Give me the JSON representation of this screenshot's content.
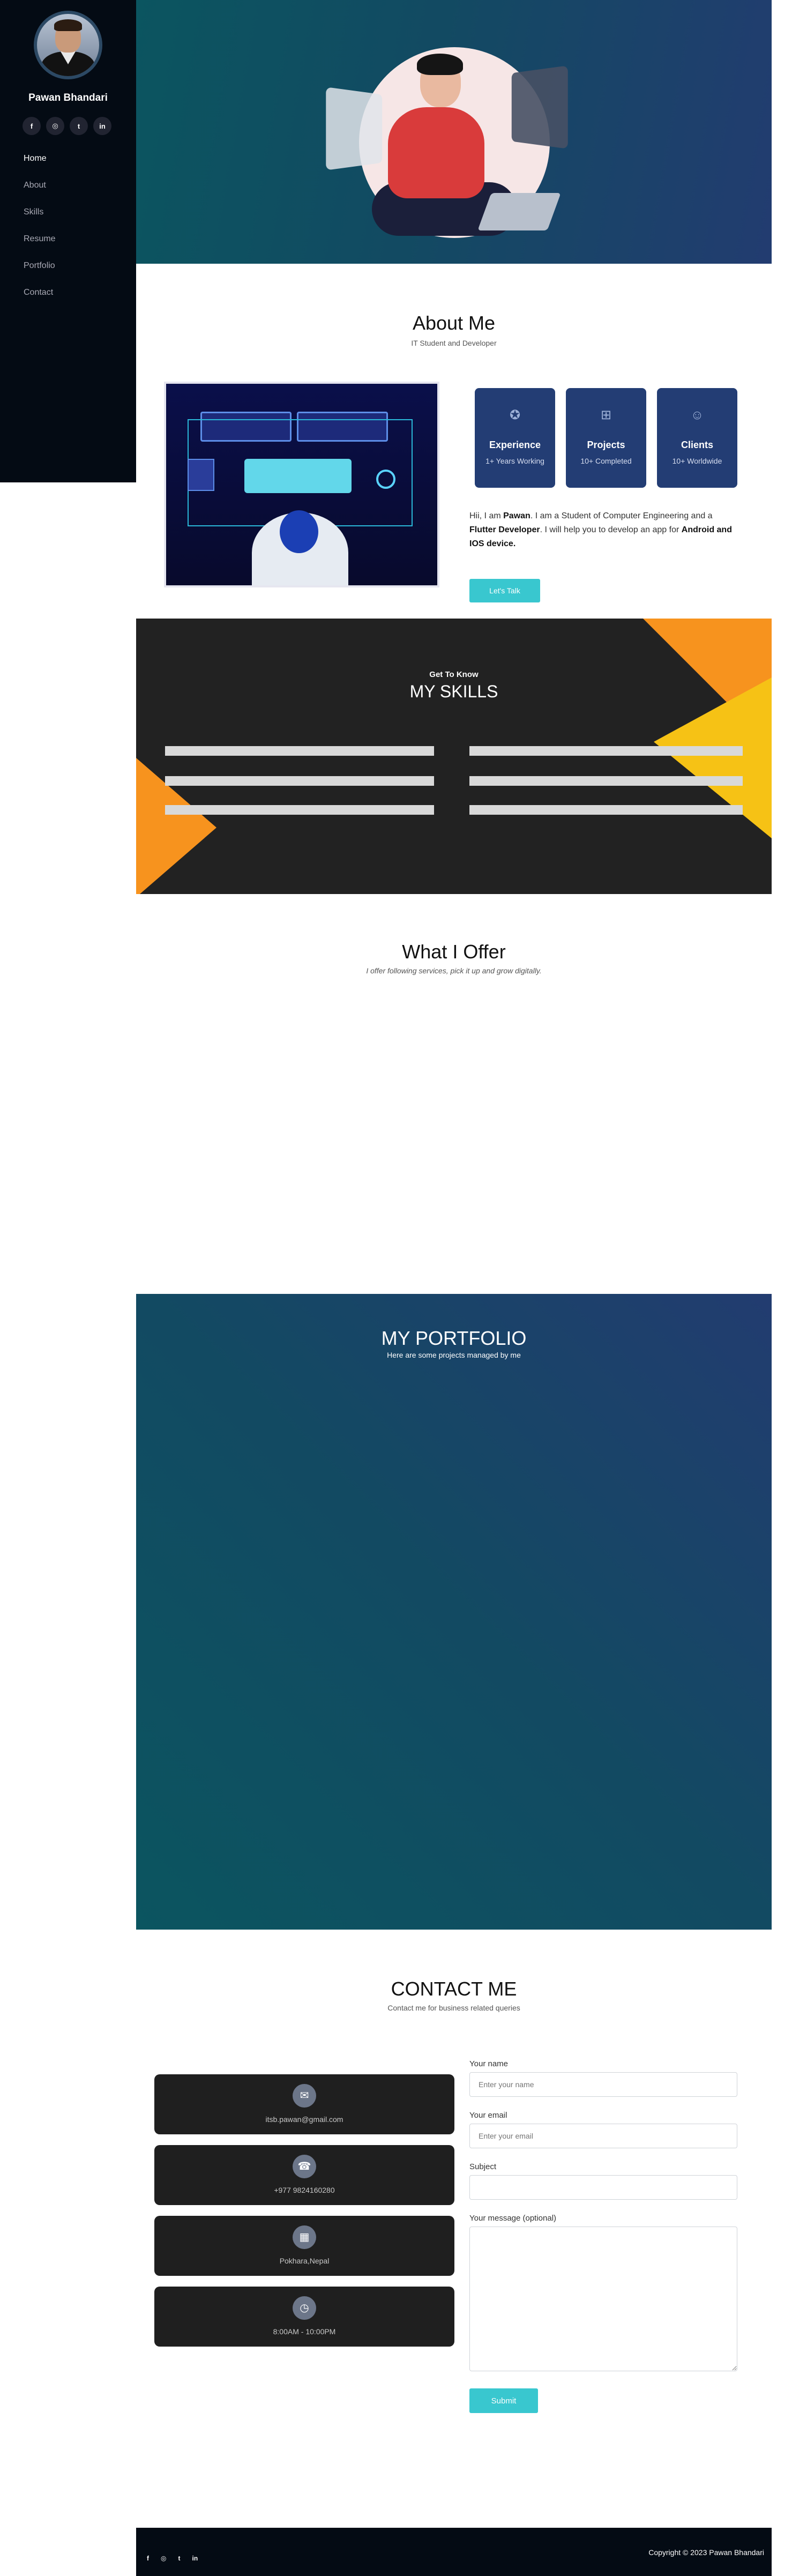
{
  "sidebar": {
    "name": "Pawan Bhandari",
    "socials": [
      "f",
      "◎",
      "t",
      "in"
    ],
    "nav": [
      "Home",
      "About",
      "Skills",
      "Resume",
      "Portfolio",
      "Contact"
    ]
  },
  "about": {
    "title": "About Me",
    "subtitle": "IT Student and Developer",
    "stats": [
      {
        "title": "Experience",
        "sub": "1+ Years Working",
        "icon": "award-icon"
      },
      {
        "title": "Projects",
        "sub": "10+ Completed",
        "icon": "sitemap-icon"
      },
      {
        "title": "Clients",
        "sub": "10+ Worldwide",
        "icon": "users-icon"
      }
    ],
    "text_1": "Hii, I am ",
    "name": "Pawan",
    "text_2": ". I am a Student of Computer Engineering and a ",
    "role": "Flutter Developer",
    "text_3": ". I will help you to develop an app for ",
    "devices": "Android and IOS device.",
    "button": "Let's Talk"
  },
  "skills": {
    "kicker": "Get To Know",
    "title": "MY SKILLS"
  },
  "offer": {
    "title": "What I Offer",
    "subtitle": "I offer following services, pick it up and grow digitally."
  },
  "portfolio": {
    "title": "MY PORTFOLIO",
    "subtitle": "Here are some projects managed by me"
  },
  "contact": {
    "title": "CONTACT ME",
    "subtitle": "Contact me for business related queries",
    "cards": [
      {
        "icon": "envelope-icon",
        "text": "itsb.pawan@gmail.com"
      },
      {
        "icon": "phone-icon",
        "text": "+977 9824160280"
      },
      {
        "icon": "building-icon",
        "text": "Pokhara,Nepal"
      },
      {
        "icon": "clock-icon",
        "text": "8:00AM - 10:00PM"
      }
    ],
    "form": {
      "name_label": "Your name",
      "name_placeholder": "Enter your name",
      "email_label": "Your email",
      "email_placeholder": "Enter your email",
      "subject_label": "Subject",
      "message_label": "Your message (optional)",
      "submit": "Submit"
    }
  },
  "footer": {
    "socials": [
      "f",
      "◎",
      "t",
      "in"
    ],
    "copyright": "Copyright © 2023 Pawan Bhandari"
  },
  "colors": {
    "sidebar_bg": "#040b14",
    "accent": "#39c7cf",
    "card_blue": "#233d74",
    "skills_bg": "#222222",
    "orange": "#f7931e",
    "yellow": "#f6c215"
  }
}
